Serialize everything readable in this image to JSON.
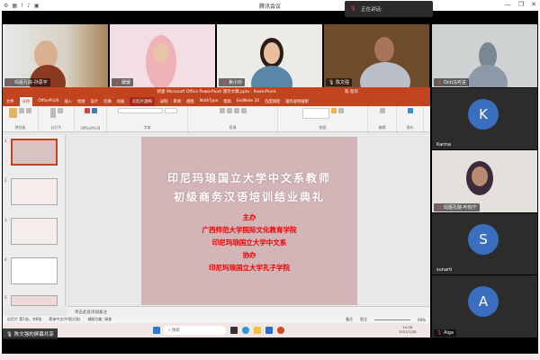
{
  "window": {
    "title": "腾讯会议"
  },
  "speaking": {
    "label": "正在讲话:"
  },
  "participants": [
    {
      "name": "玛娅孔院-孙思宇"
    },
    {
      "name": "媛媛"
    },
    {
      "name": "焦小玲"
    },
    {
      "name": "陈文强"
    },
    {
      "name": "Octi马可言"
    }
  ],
  "side": [
    {
      "initial": "K",
      "name": "Karina"
    },
    {
      "name": "玛娅孔院-叶钧宁"
    },
    {
      "initial": "S",
      "name": "sunarti"
    },
    {
      "initial": "A",
      "name": "Aiga"
    }
  ],
  "ppt": {
    "title": "新建 Microsoft Office PowerPoint 演示文稿.pptx - PowerPoint",
    "user": "陈 智华",
    "tabs": [
      "文件",
      "开始",
      "OfficePLUS",
      "插入",
      "绘图",
      "设计",
      "切换",
      "动画",
      "幻灯片放映",
      "录制",
      "审阅",
      "视图",
      "MathType",
      "帮助",
      "EndNote 20",
      "百度网盘",
      "操作说明搜索"
    ],
    "groups": [
      "剪贴板",
      "幻灯片",
      "OfficePLUS",
      "字体",
      "段落",
      "绘图",
      "编辑",
      "保存"
    ],
    "slide": {
      "title1": "印尼玛琅国立大学中文系教师",
      "title2": "初级商务汉语培训结业典礼",
      "host_label": "主办",
      "host1": "广西师范大学国际文化教育学院",
      "host2": "印尼玛琅国立大学中文系",
      "co_label": "协办",
      "co1": "印尼玛琅国立大学孔子学院"
    },
    "notes_placeholder": "单击此处添加备注",
    "status": {
      "slide": "幻灯片 第1张，共8张",
      "lang": "简体中文(中国大陆)",
      "access": "辅助功能: 调查",
      "notes": "备注",
      "comments": "批注",
      "zoom": "60%"
    },
    "thumb_numbers": [
      "1",
      "2",
      "3",
      "4",
      "5"
    ]
  },
  "taskbar": {
    "search": "搜索",
    "time": "10:26",
    "date": "2023/7/28"
  },
  "share_label": "陈文强的屏幕共享"
}
